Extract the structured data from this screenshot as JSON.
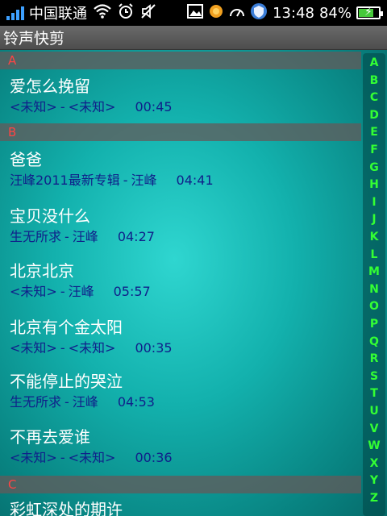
{
  "status_bar": {
    "carrier": "中国联通",
    "time": "13:48",
    "battery": "84%",
    "battery_level": 0.84
  },
  "title": "铃声快剪",
  "sections": [
    {
      "letter": "A"
    },
    {
      "letter": "B"
    },
    {
      "letter": "C"
    }
  ],
  "songs": [
    {
      "title": "爱怎么挽留",
      "album": "<未知>",
      "artist": "<未知>",
      "duration": "00:45"
    },
    {
      "title": "爸爸",
      "album": "汪峰2011最新专辑",
      "artist": "汪峰",
      "duration": "04:41"
    },
    {
      "title": "宝贝没什么",
      "album": "生无所求",
      "artist": "汪峰",
      "duration": "04:27"
    },
    {
      "title": "北京北京",
      "album": "<未知>",
      "artist": "汪峰",
      "duration": "05:57"
    },
    {
      "title": "北京有个金太阳",
      "album": "<未知>",
      "artist": "<未知>",
      "duration": "00:35"
    },
    {
      "title": "不能停止的哭泣",
      "album": "生无所求",
      "artist": "汪峰",
      "duration": "04:53"
    },
    {
      "title": "不再去爱谁",
      "album": "<未知>",
      "artist": "<未知>",
      "duration": "00:36"
    },
    {
      "title": "彩虹深处的期许"
    }
  ],
  "meta_separator": "-",
  "index_letters": [
    "A",
    "B",
    "C",
    "D",
    "E",
    "F",
    "G",
    "H",
    "I",
    "J",
    "K",
    "L",
    "M",
    "N",
    "O",
    "P",
    "Q",
    "R",
    "S",
    "T",
    "U",
    "V",
    "W",
    "X",
    "Y",
    "Z"
  ],
  "colors": {
    "accent_index": "#33ff33",
    "section_letter": "#ff4444",
    "meta_text": "#10208a"
  }
}
